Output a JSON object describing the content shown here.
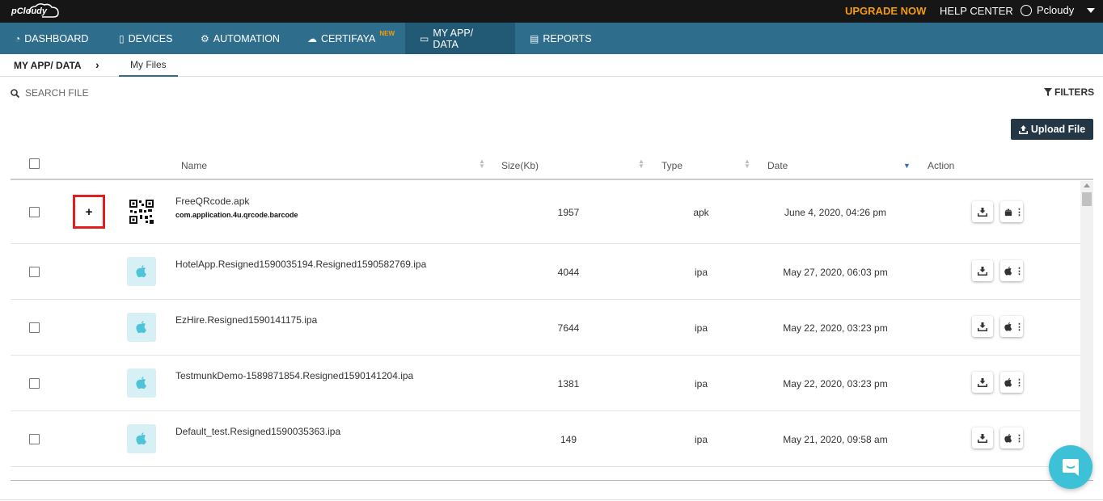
{
  "topbar": {
    "logo_text": "pCloudy",
    "upgrade_label": "UPGRADE NOW",
    "help_label": "HELP CENTER",
    "user_name": "Pcloudy"
  },
  "nav": {
    "dashboard": "DASHBOARD",
    "devices": "DEVICES",
    "automation": "AUTOMATION",
    "certifaya": "CERTIFAYA",
    "new_badge": "NEW",
    "myapp": "MY APP/ DATA",
    "reports": "REPORTS"
  },
  "breadcrumb": {
    "section": "MY APP/ DATA",
    "tab": "My Files"
  },
  "search": {
    "placeholder": "SEARCH FILE"
  },
  "filters_label": "FILTERS",
  "upload_label": "Upload File",
  "table": {
    "headers": {
      "name": "Name",
      "size": "Size(Kb)",
      "type": "Type",
      "date": "Date",
      "action": "Action"
    },
    "rows": [
      {
        "name": "FreeQRcode.apk",
        "package": "com.application.4u.qrcode.barcode",
        "size": "1957",
        "type": "apk",
        "date": "June 4, 2020, 04:26 pm"
      },
      {
        "name": "HotelApp.Resigned1590035194.Resigned1590582769.ipa",
        "size": "4044",
        "type": "ipa",
        "date": "May 27, 2020, 06:03 pm"
      },
      {
        "name": "EzHire.Resigned1590141175.ipa",
        "size": "7644",
        "type": "ipa",
        "date": "May 22, 2020, 03:23 pm"
      },
      {
        "name": "TestmunkDemo-1589871854.Resigned1590141204.ipa",
        "size": "1381",
        "type": "ipa",
        "date": "May 22, 2020, 03:23 pm"
      },
      {
        "name": "Default_test.Resigned1590035363.ipa",
        "size": "149",
        "type": "ipa",
        "date": "May 21, 2020, 09:58 am"
      }
    ]
  }
}
